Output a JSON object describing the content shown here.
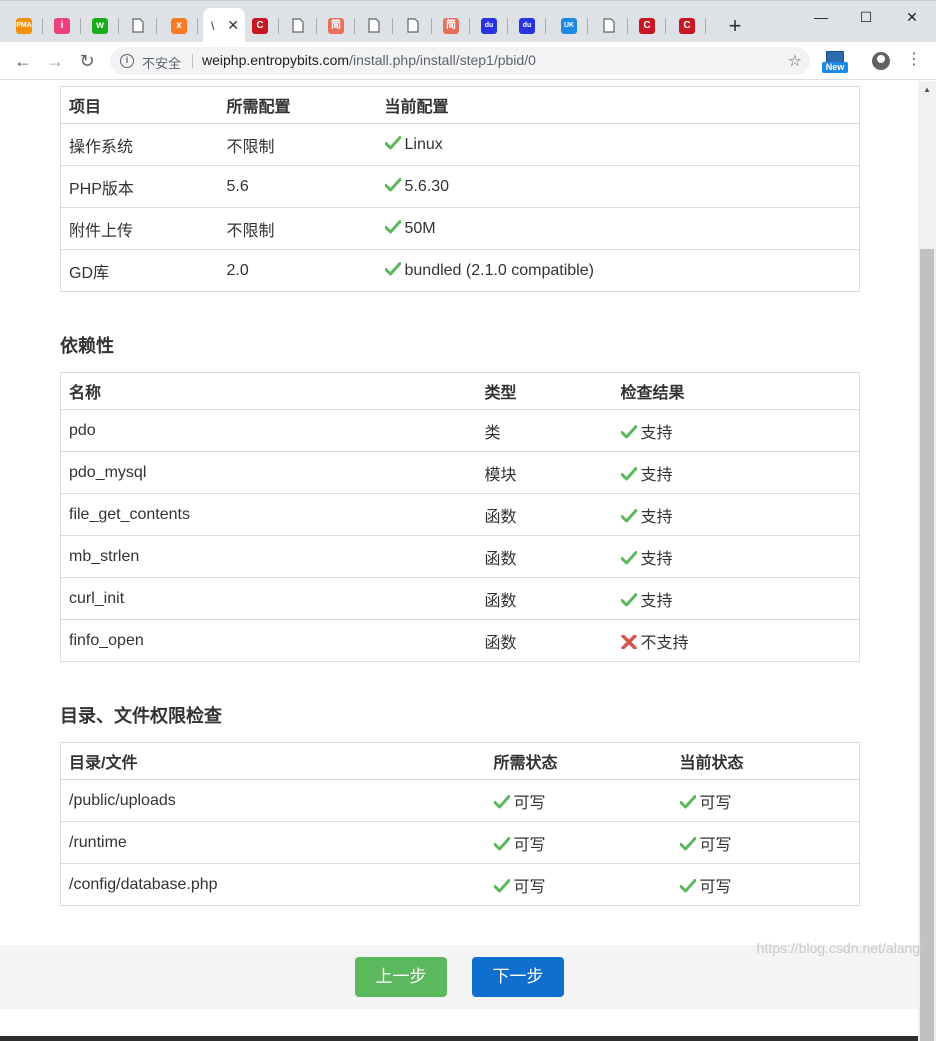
{
  "browser": {
    "tabs": [
      {
        "icon": "pma-icon",
        "text": "PMA",
        "color": "#f29111"
      },
      {
        "icon": "pink-app-icon",
        "text": "i",
        "color": "#ec407a"
      },
      {
        "icon": "wechat-shield-icon",
        "text": "w",
        "color": "#1aad19"
      },
      {
        "icon": "page-icon",
        "text": "",
        "color": ""
      },
      {
        "icon": "xampp-icon",
        "text": "x",
        "color": "#fb7a24"
      },
      {
        "icon": "csdn-icon",
        "text": "C",
        "color": "#c81623"
      },
      {
        "icon": "page-icon",
        "text": "",
        "color": ""
      },
      {
        "icon": "jian-icon",
        "text": "简",
        "color": "#ea6f5a"
      },
      {
        "icon": "page-icon",
        "text": "",
        "color": ""
      },
      {
        "icon": "page-icon",
        "text": "",
        "color": ""
      },
      {
        "icon": "jian-icon",
        "text": "简",
        "color": "#ea6f5a"
      },
      {
        "icon": "baidu-paw-icon",
        "text": "du",
        "color": "#2932e1"
      },
      {
        "icon": "baidu-paw-icon",
        "text": "du",
        "color": "#2932e1"
      },
      {
        "icon": "uk-icon",
        "text": "UK",
        "color": "#1e88e5"
      },
      {
        "icon": "page-icon",
        "text": "",
        "color": ""
      },
      {
        "icon": "csdn-icon",
        "text": "C",
        "color": "#c81623"
      },
      {
        "icon": "csdn-icon",
        "text": "C",
        "color": "#c81623"
      }
    ],
    "active_tab_text": "\\",
    "active_tab_close": "✕",
    "new_tab": "+",
    "win_min": "—",
    "win_max": "☐",
    "win_close": "✕",
    "back": "←",
    "forward": "→",
    "reload": "↻",
    "insecure_label": "不安全",
    "url_host": "weiphp.entropybits.com",
    "url_path": "/install.php/install/step1/pbid/0",
    "ext_new_label": "New",
    "menu": "⋮",
    "star": "☆"
  },
  "env_table": {
    "headers": [
      "项目",
      "所需配置",
      "当前配置"
    ],
    "rows": [
      [
        "操作系统",
        "不限制",
        "Linux"
      ],
      [
        "PHP版本",
        "5.6",
        "5.6.30"
      ],
      [
        "附件上传",
        "不限制",
        "50M"
      ],
      [
        "GD库",
        "2.0",
        "bundled (2.1.0 compatible)"
      ]
    ]
  },
  "deps_section": {
    "title": "依赖性",
    "headers": [
      "名称",
      "类型",
      "检查结果"
    ],
    "rows": [
      {
        "name": "pdo",
        "type": "类",
        "result": "支持",
        "ok": true
      },
      {
        "name": "pdo_mysql",
        "type": "模块",
        "result": "支持",
        "ok": true
      },
      {
        "name": "file_get_contents",
        "type": "函数",
        "result": "支持",
        "ok": true
      },
      {
        "name": "mb_strlen",
        "type": "函数",
        "result": "支持",
        "ok": true
      },
      {
        "name": "curl_init",
        "type": "函数",
        "result": "支持",
        "ok": true
      },
      {
        "name": "finfo_open",
        "type": "函数",
        "result": "不支持",
        "ok": false
      }
    ]
  },
  "dirs_section": {
    "title": "目录、文件权限检查",
    "headers": [
      "目录/文件",
      "所需状态",
      "当前状态"
    ],
    "rows": [
      [
        "/public/uploads",
        "可写",
        "可写"
      ],
      [
        "/runtime",
        "可写",
        "可写"
      ],
      [
        "/config/database.php",
        "可写",
        "可写"
      ]
    ]
  },
  "footer": {
    "prev_label": "上一步",
    "next_label": "下一步"
  },
  "watermark": "https://blog.csdn.net/alangf",
  "colors": {
    "ok": "#5cb85c",
    "fail": "#d9534f",
    "prev_button": "#5cb85c",
    "next_button": "#0e6fcf"
  }
}
